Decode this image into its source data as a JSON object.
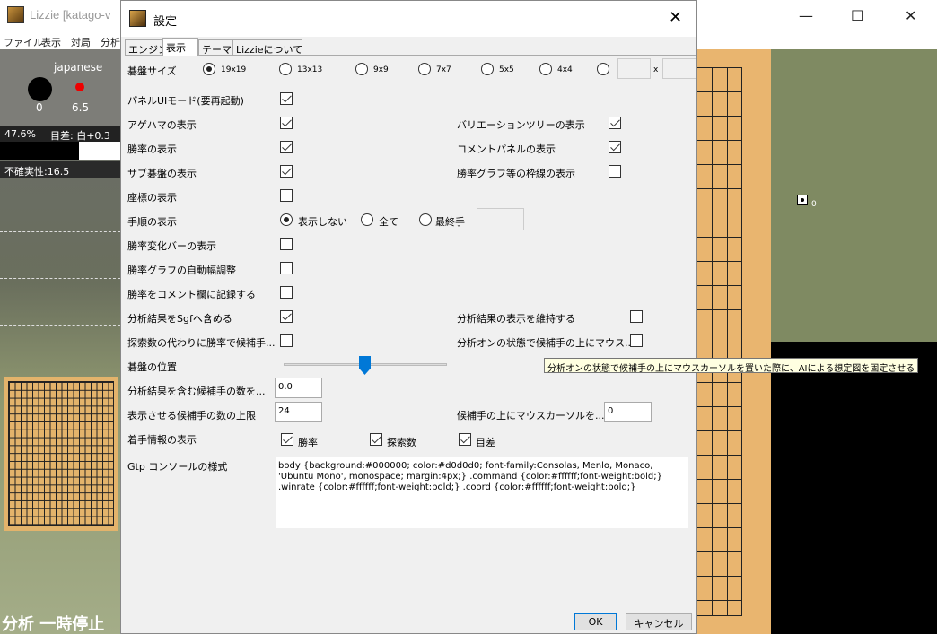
{
  "background_window": {
    "title": "Lizzie [katago-v",
    "menu": [
      "ファイル",
      "表示",
      "対局",
      "分析"
    ],
    "rules": "japanese",
    "captures_black": "0",
    "komi": "6.5",
    "winrate": "47.6%",
    "score_diff": "目差: 白+0.3",
    "uncertainty": "不確実性:16.5",
    "status": "分析 一時停止",
    "selected_move_label": "0",
    "controls": {
      "minimize": "—",
      "maximize": "☐",
      "close": "✕"
    }
  },
  "dialog": {
    "title": "設定",
    "close": "✕",
    "tabs": [
      "エンジン",
      "表示",
      "テーマ",
      "Lizzieについて"
    ],
    "active_tab": "表示",
    "board_size": {
      "label": "碁盤サイズ",
      "options": [
        "19x19",
        "13x13",
        "9x9",
        "7x7",
        "5x5",
        "4x4"
      ],
      "selected": "19x19",
      "custom_separator": "x"
    },
    "panel_ui": {
      "label": "パネルUIモード(要再起動)",
      "checked": true
    },
    "left_options": [
      {
        "label": "アゲハマの表示",
        "checked": true
      },
      {
        "label": "勝率の表示",
        "checked": true
      },
      {
        "label": "サブ碁盤の表示",
        "checked": true
      },
      {
        "label": "座標の表示",
        "checked": false
      }
    ],
    "right_options": [
      {
        "label": "バリエーションツリーの表示",
        "checked": true
      },
      {
        "label": "コメントパネルの表示",
        "checked": true
      },
      {
        "label": "勝率グラフ等の枠線の表示",
        "checked": false
      }
    ],
    "move_number": {
      "label": "手順の表示",
      "options": [
        "表示しない",
        "全て",
        "最終手"
      ],
      "selected": "表示しない"
    },
    "more_options": [
      {
        "label": "勝率変化バーの表示",
        "checked": false
      },
      {
        "label": "勝率グラフの自動幅調整",
        "checked": false
      },
      {
        "label": "勝率をコメント欄に記録する",
        "checked": false
      }
    ],
    "sgf_option": {
      "label": "分析結果をSgfへ含める",
      "checked": true
    },
    "keep_analysis": {
      "label": "分析結果の表示を維持する",
      "checked": false
    },
    "playouts_option": {
      "label": "探索数の代わりに勝率で候補手...",
      "checked": false
    },
    "hover_option": {
      "label": "分析オンの状態で候補手の上にマウス...",
      "checked": false
    },
    "board_position": {
      "label": "碁盤の位置",
      "value": 0.5
    },
    "tooltip": "分析オンの状態で候補手の上にマウスカーソルを置いた際に、AIによる想定図を固定させる",
    "min_candidates": {
      "label": "分析結果を含む候補手の数を...",
      "value": "0.0"
    },
    "max_candidates": {
      "label": "表示させる候補手の数の上限",
      "value": "24"
    },
    "hover_moves": {
      "label": "候補手の上にマウスカーソルを...",
      "value": "0"
    },
    "move_info": {
      "label": "着手情報の表示",
      "options": [
        {
          "label": "勝率",
          "checked": true
        },
        {
          "label": "探索数",
          "checked": true
        },
        {
          "label": "目差",
          "checked": true
        }
      ]
    },
    "gtp_console": {
      "label": "Gtp コンソールの様式",
      "value": "body {background:#000000; color:#d0d0d0; font-family:Consolas, Menlo, Monaco, 'Ubuntu Mono', monospace; margin:4px;} .command {color:#ffffff;font-weight:bold;} .winrate {color:#ffffff;font-weight:bold;} .coord {color:#ffffff;font-weight:bold;}"
    },
    "ok": "OK",
    "cancel": "キャンセル"
  }
}
